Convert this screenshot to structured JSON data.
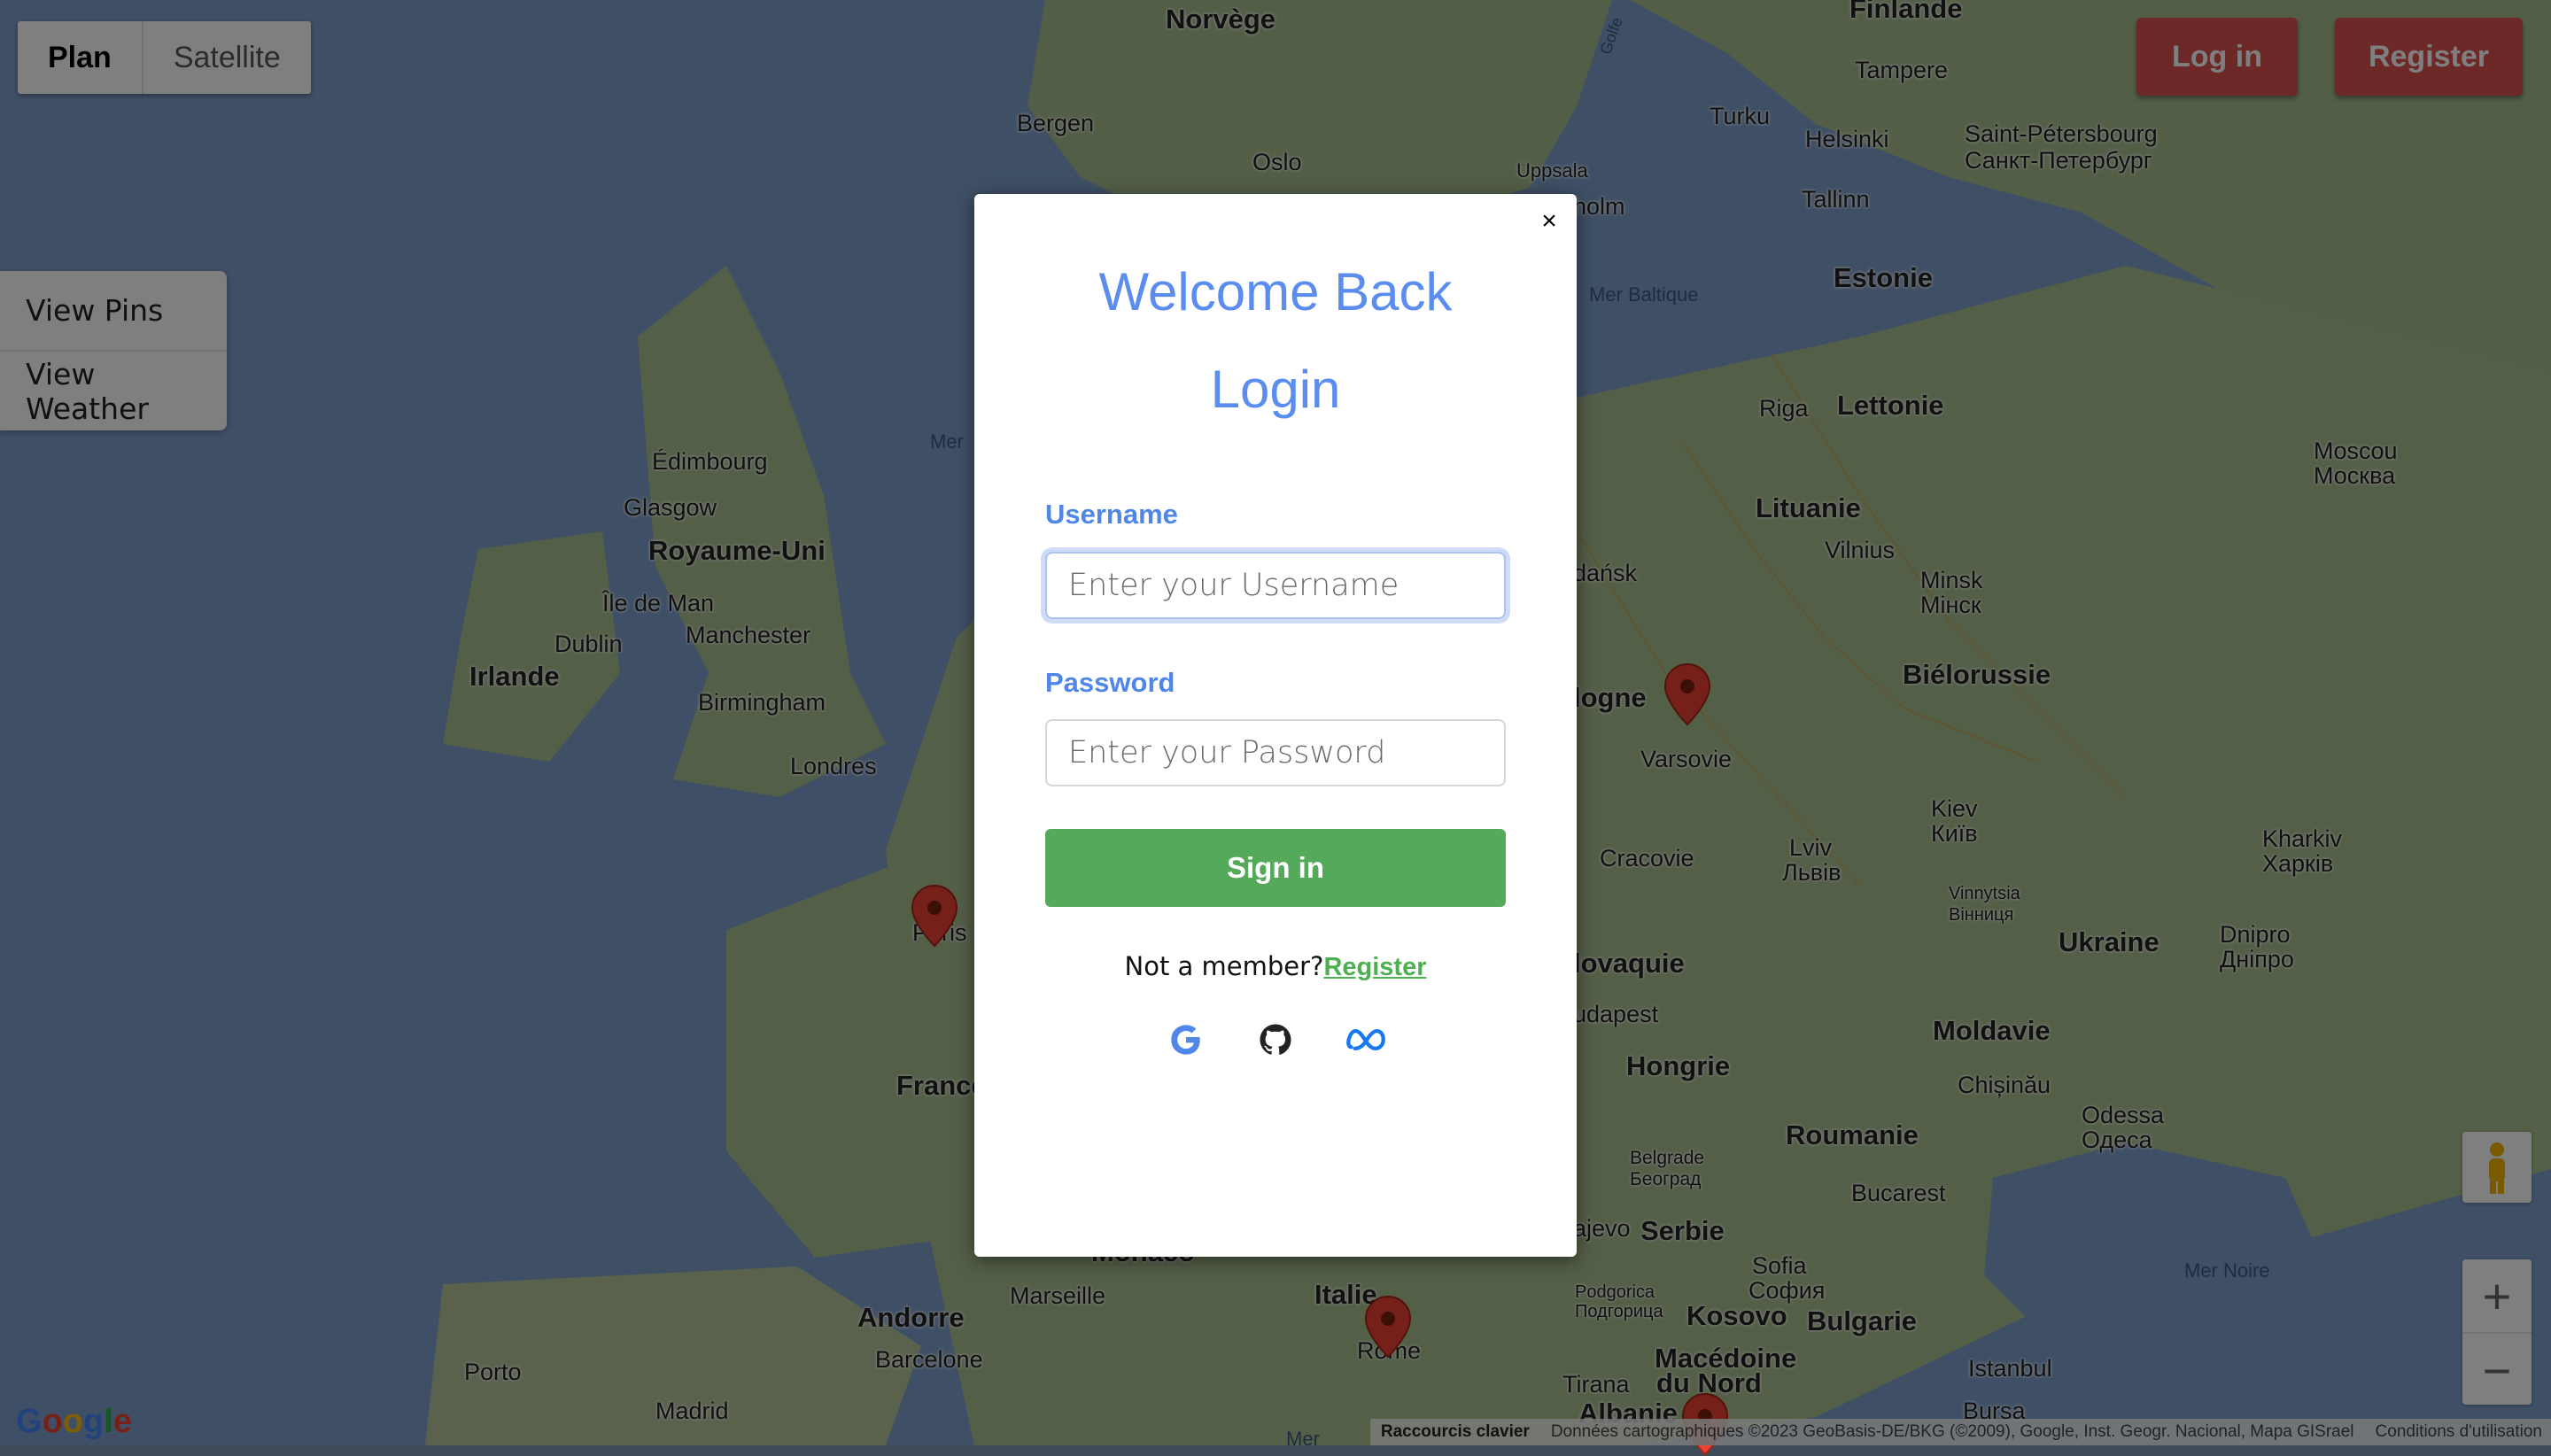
{
  "map": {
    "map_type_buttons": {
      "plan": "Plan",
      "satellite": "Satellite"
    },
    "labels": {
      "norvege": "Norvège",
      "finlande": "Finlande",
      "bergen": "Bergen",
      "oslo": "Oslo",
      "uppsala": "Uppsala",
      "stockholm_part": "holm",
      "turku": "Turku",
      "helsinki": "Helsinki",
      "tampere": "Tampere",
      "stpete_fr": "Saint-Pétersbourg",
      "stpete_ru": "Санкт-Петербург",
      "tallinn": "Tallinn",
      "estonie": "Estonie",
      "mer_baltique": "Mer Baltique",
      "riga": "Riga",
      "lettonie": "Lettonie",
      "moscou": "Moscou",
      "moskva": "Москва",
      "lituanie": "Lituanie",
      "vilnius": "Vilnius",
      "gdansk_part": "dańsk",
      "minsk": "Minsk",
      "minsk_ru": "Мінск",
      "bielorussie": "Biélorussie",
      "pologne_part": "logne",
      "varsovie": "Varsovie",
      "kiev": "Kiev",
      "kyiv": "Київ",
      "kharkiv": "Kharkiv",
      "kharkiv_ua": "Харків",
      "cracovie": "Cracovie",
      "lviv": "Lviv",
      "lviv_ua": "Львів",
      "vinnytsia": "Vinnytsia",
      "vinnytsia_ua": "Вінниця",
      "ukraine": "Ukraine",
      "dnipro": "Dnipro",
      "dnipro_ua": "Дніпро",
      "slovaquie_part": "lovaquie",
      "budapest_part": "udapest",
      "hongrie": "Hongrie",
      "moldavie": "Moldavie",
      "chisinau": "Chișinău",
      "odessa": "Odessa",
      "odessa_ua": "Одеса",
      "roumanie": "Roumanie",
      "belgrade": "Belgrade",
      "beograd": "Београд",
      "bucarest": "Bucarest",
      "sarajevo_part": "ajevo",
      "serbie": "Serbie",
      "sofia": "Sofia",
      "sofia_bg": "София",
      "mer_noire": "Mer Noire",
      "podgorica": "Podgorica",
      "podgorica_me": "Подгорица",
      "kosovo": "Kosovo",
      "bulgarie": "Bulgarie",
      "macedoine": "Macédoine",
      "du_nord": "du Nord",
      "tirana": "Tirana",
      "albanie": "Albanie",
      "istanbul": "Istanbul",
      "bursa": "Bursa",
      "italie": "Italie",
      "rome": "Rome",
      "edimbourg": "Édimbourg",
      "glasgow": "Glasgow",
      "royaume_uni": "Royaume-Uni",
      "ile_de_man": "Île de Man",
      "manchester": "Manchester",
      "dublin": "Dublin",
      "irlande": "Irlande",
      "birmingham": "Birmingham",
      "londres": "Londres",
      "paris": "Paris",
      "france": "France",
      "marseille": "Marseille",
      "monaco_part": "Monaco",
      "andorre": "Andorre",
      "barcelone": "Barcelone",
      "porto": "Porto",
      "madrid": "Madrid",
      "mer_part": "Mer",
      "golfe": "Golfe"
    },
    "google_logo": "Google",
    "attribution": {
      "shortcuts": "Raccourcis clavier",
      "data": "Données cartographiques ©2023 GeoBasis-DE/BKG (©2009), Google, Inst. Geogr. Nacional, Mapa GISrael",
      "terms": "Conditions d'utilisation"
    },
    "controls": {
      "zoom_in": "+",
      "zoom_out": "−"
    }
  },
  "header": {
    "login_label": "Log in",
    "register_label": "Register"
  },
  "sidemenu": {
    "items": [
      {
        "label": "View Pins"
      },
      {
        "label": "View Weather"
      }
    ]
  },
  "modal": {
    "close_label": "×",
    "title_line1": "Welcome Back",
    "title_line2": "Login",
    "username_label": "Username",
    "username_placeholder": "Enter your Username",
    "password_label": "Password",
    "password_placeholder": "Enter your Password",
    "signin_label": "Sign in",
    "not_member": "Not a member?",
    "register_link": "Register",
    "social": [
      "google-icon",
      "github-icon",
      "meta-icon"
    ]
  },
  "colors": {
    "primary_blue": "#5b8def",
    "signin_green": "#55a95a",
    "header_red": "#d9534f",
    "link_green": "#4caf50"
  }
}
